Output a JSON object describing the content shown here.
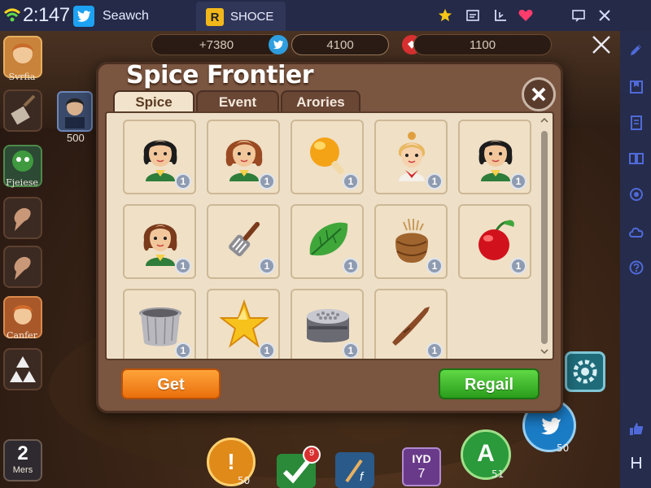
{
  "topbar": {
    "clock": "2:147",
    "search_label": "Seawch",
    "app_tab_icon": "R",
    "app_tab_label": "SHOCE",
    "icons": [
      "star-icon",
      "picture-icon",
      "chart-icon",
      "heart-icon",
      "chat-icon",
      "close-icon"
    ]
  },
  "right_sidebar": {
    "icons": [
      "pen-icon",
      "bookmark-icon",
      "document-icon",
      "split-view-icon",
      "record-icon",
      "cloud-icon",
      "help-icon",
      "thumbs-up-icon",
      "dock-icon"
    ]
  },
  "currency": {
    "left_value": "+7380",
    "center_value": "4100",
    "right_value": "1100"
  },
  "left_column": {
    "items": [
      {
        "label": "Svrfia"
      },
      {
        "label": ""
      },
      {
        "label": "Fjeiese"
      },
      {
        "label": ""
      },
      {
        "label": ""
      },
      {
        "label": "Canfer"
      },
      {
        "label": ""
      }
    ],
    "avatar_count": "500",
    "bottom_number": "2",
    "bottom_label": "Mers"
  },
  "bottom_bar": {
    "counts": [
      "50",
      "9",
      "50",
      "51"
    ],
    "f_label": "f",
    "tyd_label": "IYD",
    "tyd_number": "7",
    "a_label": "A"
  },
  "modal": {
    "title": "Spice Frontier",
    "tabs": [
      {
        "label": "Spice",
        "active": true
      },
      {
        "label": "Event",
        "active": false
      },
      {
        "label": "Arories",
        "active": false
      }
    ],
    "items": [
      {
        "icon": "woman-black-hair-icon",
        "count": "1"
      },
      {
        "icon": "woman-auburn-hair-icon",
        "count": "1"
      },
      {
        "icon": "orange-spoon-icon",
        "count": "1"
      },
      {
        "icon": "chef-woman-icon",
        "count": "1"
      },
      {
        "icon": "woman-black-hair-icon",
        "count": "1"
      },
      {
        "icon": "woman-brown-hair-icon",
        "count": "1"
      },
      {
        "icon": "spatula-icon",
        "count": "1"
      },
      {
        "icon": "leaf-icon",
        "count": "1"
      },
      {
        "icon": "basket-icon",
        "count": "1"
      },
      {
        "icon": "cherry-icon",
        "count": "1"
      },
      {
        "icon": "pot-icon",
        "count": "1"
      },
      {
        "icon": "star-icon",
        "count": "1"
      },
      {
        "icon": "tin-icon",
        "count": "1"
      },
      {
        "icon": "stick-icon",
        "count": "1"
      }
    ],
    "get_label": "Get",
    "regail_label": "Regail"
  },
  "colors": {
    "topbar": "#242a48",
    "modal_frame": "#7a5540",
    "panel": "#eee0c8",
    "get_button": "#ef7f18",
    "regail_button": "#36b325",
    "sidebar_icon": "#4f6ad8"
  }
}
